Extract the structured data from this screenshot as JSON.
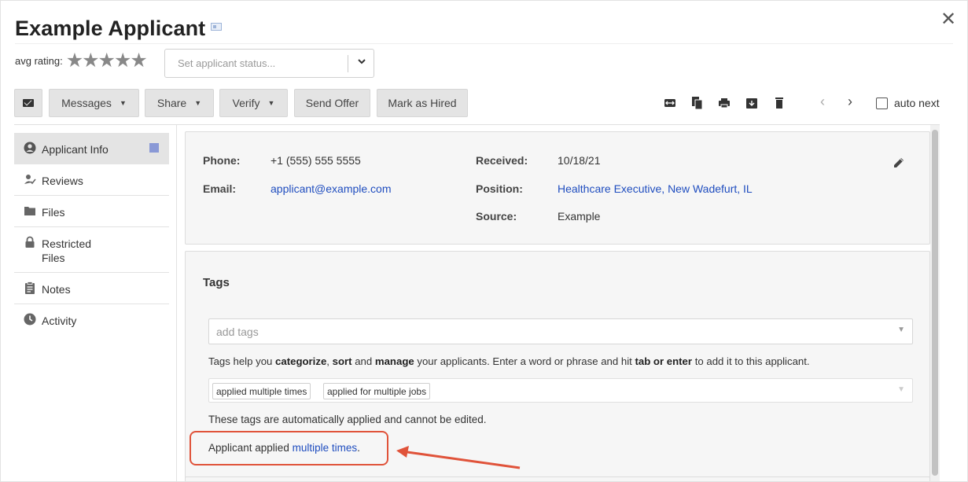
{
  "header": {
    "title": "Example Applicant",
    "close_glyph": "✕",
    "rating_label": "avg rating:",
    "stars": "★★★★★",
    "rating_value": 0,
    "rating_max": 5,
    "status_placeholder": "Set applicant status..."
  },
  "toolbar": {
    "messages": "Messages",
    "share": "Share",
    "verify": "Verify",
    "send_offer": "Send Offer",
    "mark_hired": "Mark as Hired",
    "auto_next": "auto next"
  },
  "sidebar": {
    "items": [
      {
        "label": "Applicant Info",
        "icon": "user-circle-icon"
      },
      {
        "label": "Reviews",
        "icon": "user-check-icon"
      },
      {
        "label": "Files",
        "icon": "folder-icon"
      },
      {
        "label": "Restricted Files",
        "icon": "lock-icon"
      },
      {
        "label": "Notes",
        "icon": "clipboard-icon"
      },
      {
        "label": "Activity",
        "icon": "clock-icon"
      }
    ],
    "active_badge_color": "#8a99d6"
  },
  "info": {
    "phone_label": "Phone:",
    "phone": "+1 (555) 555 5555",
    "email_label": "Email:",
    "email": "applicant@example.com",
    "received_label": "Received:",
    "received": "10/18/21",
    "position_label": "Position:",
    "position": "Healthcare Executive, New Wadefurt, IL",
    "source_label": "Source:",
    "source": "Example"
  },
  "tags": {
    "heading": "Tags",
    "input_placeholder": "add tags",
    "help_1": "Tags help you ",
    "help_b1": "categorize",
    "help_2": ", ",
    "help_b2": "sort",
    "help_3": " and ",
    "help_b3": "manage",
    "help_4": " your applicants. Enter a word or phrase and hit ",
    "help_b4": "tab or enter",
    "help_5": " to add it to this applicant.",
    "auto_tags": [
      "applied multiple times",
      "applied for multiple jobs"
    ],
    "auto_note": "These tags are automatically applied and cannot be edited.",
    "applied_prefix": "Applicant applied ",
    "applied_link": "multiple times",
    "applied_suffix": "."
  },
  "colors": {
    "link": "#1f4dbf",
    "annotation": "#e0533a"
  }
}
